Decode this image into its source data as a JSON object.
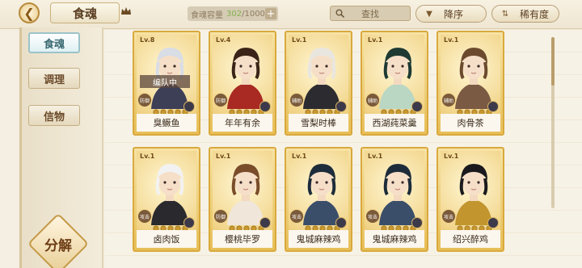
{
  "header": {
    "title": "食魂",
    "capacity_label": "食魂容量",
    "capacity_used": "302",
    "capacity_total": "/1000",
    "capacity_add": "+",
    "search_placeholder": "查找",
    "sort_label": "降序",
    "rarity_label": "稀有度"
  },
  "sidebar": {
    "tabs": [
      {
        "label": "食魂",
        "active": true
      },
      {
        "label": "调理",
        "active": false
      },
      {
        "label": "信物",
        "active": false
      }
    ],
    "decompose_label": "分解"
  },
  "cards": [
    {
      "level": "Lv.8",
      "name": "臭鳜鱼",
      "badge": "编队中",
      "hair": "#d8dde6",
      "coat": "#3d3f57",
      "tag": "防御"
    },
    {
      "level": "Lv.4",
      "name": "年年有余",
      "badge": "",
      "hair": "#3a2418",
      "coat": "#a82a22",
      "tag": "防御"
    },
    {
      "level": "Lv.1",
      "name": "雪梨时棒",
      "badge": "",
      "hair": "#e9e6e0",
      "coat": "#2c2c30",
      "tag": "辅助"
    },
    {
      "level": "Lv.1",
      "name": "西湖莼菜羹",
      "badge": "",
      "hair": "#1e3a33",
      "coat": "#b9d7c3",
      "tag": "辅助"
    },
    {
      "level": "Lv.1",
      "name": "肉骨茶",
      "badge": "",
      "hair": "#6b4a2e",
      "coat": "#7a5a42",
      "tag": "辅助"
    },
    {
      "level": "Lv.1",
      "name": "卤肉饭",
      "badge": "",
      "hair": "#f2f2f2",
      "coat": "#2a2a2e",
      "tag": "攻击"
    },
    {
      "level": "Lv.1",
      "name": "樱桃毕罗",
      "badge": "",
      "hair": "#7a4d2a",
      "coat": "#f0e6d9",
      "tag": "防御"
    },
    {
      "level": "Lv.1",
      "name": "鬼城麻辣鸡",
      "badge": "",
      "hair": "#1d2c3a",
      "coat": "#3a4e6a",
      "tag": "攻击"
    },
    {
      "level": "Lv.1",
      "name": "鬼城麻辣鸡",
      "badge": "",
      "hair": "#1d2c3a",
      "coat": "#3a4e6a",
      "tag": "攻击"
    },
    {
      "level": "Lv.1",
      "name": "绍兴醉鸡",
      "badge": "",
      "hair": "#1a1a1e",
      "coat": "#c2952e",
      "tag": "攻击"
    }
  ],
  "colors": {
    "accent": "#d9a93d",
    "active_tab": "#9cc3c9",
    "capacity_used": "#7fb34c"
  },
  "icons": [
    "back-chevron-icon",
    "crown-icon",
    "search-icon",
    "sort-icon",
    "rarity-filter-icon"
  ]
}
